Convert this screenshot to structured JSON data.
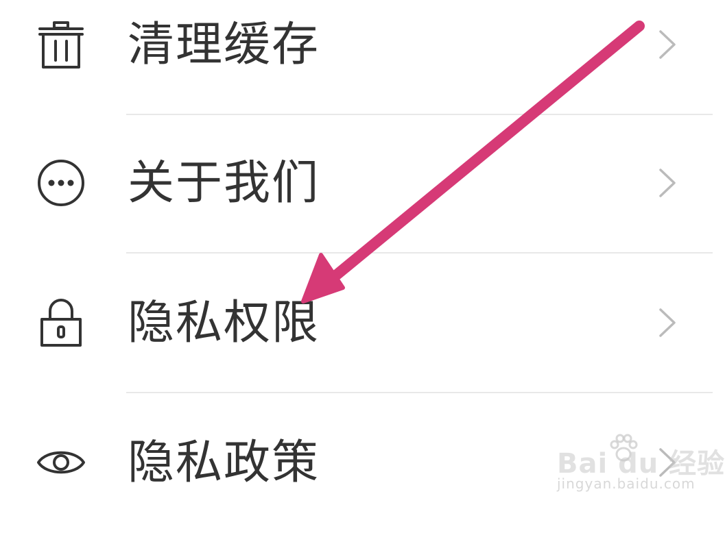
{
  "menu": {
    "items": [
      {
        "label": "清理缓存",
        "icon": "trash-icon"
      },
      {
        "label": "关于我们",
        "icon": "more-dots-circle-icon"
      },
      {
        "label": "隐私权限",
        "icon": "lock-icon"
      },
      {
        "label": "隐私政策",
        "icon": "eye-icon"
      }
    ]
  },
  "annotation": {
    "arrow_color": "#d63a76",
    "points_to": "隐私权限"
  },
  "watermark": {
    "brand": "Bai du 经验",
    "url": "jingyan.baidu.com"
  },
  "colors": {
    "text": "#333333",
    "icon_stroke": "#333333",
    "chevron": "#bbbbbb",
    "divider": "#e8e8e8",
    "background": "#ffffff"
  }
}
